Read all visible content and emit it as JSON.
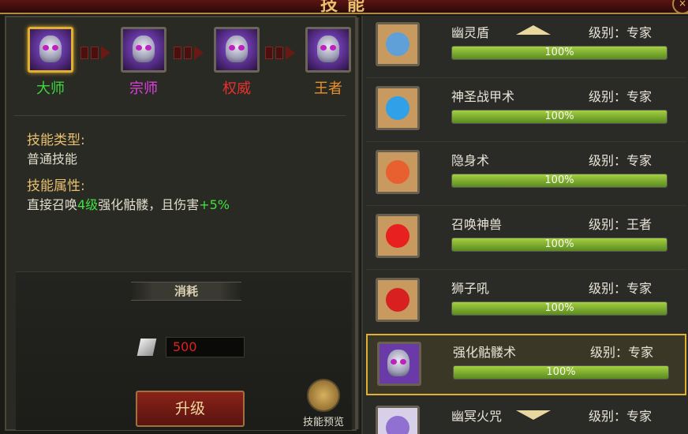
{
  "window": {
    "title": "技能",
    "close_icon": "close-icon"
  },
  "tiers": [
    {
      "label": "大师",
      "color": "#3cd83c",
      "selected": true
    },
    {
      "label": "宗师",
      "color": "#e040e0",
      "selected": false
    },
    {
      "label": "权威",
      "color": "#e83030",
      "selected": false
    },
    {
      "label": "王者",
      "color": "#e8902a",
      "selected": false
    }
  ],
  "info": {
    "type_heading": "技能类型:",
    "type_value": "普通技能",
    "attr_heading": "技能属性:",
    "attr_prefix": "直接召唤",
    "attr_level": "4级",
    "attr_mid": "强化骷髅，且伤害",
    "attr_bonus": "+5%"
  },
  "cost": {
    "banner": "消耗",
    "value": "500"
  },
  "upgrade_label": "升级",
  "preview_label": "技能预览",
  "skills": [
    {
      "name": "幽灵盾",
      "level": "级别：专家",
      "progress": "100%",
      "icon": "ghost-shield-icon",
      "icon_color": "#60a0d8"
    },
    {
      "name": "神圣战甲术",
      "level": "级别：专家",
      "progress": "100%",
      "icon": "holy-armor-icon",
      "icon_color": "#30a0e8"
    },
    {
      "name": "隐身术",
      "level": "级别：专家",
      "progress": "100%",
      "icon": "stealth-icon",
      "icon_color": "#e86030"
    },
    {
      "name": "召唤神兽",
      "level": "级别：王者",
      "progress": "100%",
      "icon": "summon-beast-icon",
      "icon_color": "#e82020"
    },
    {
      "name": "狮子吼",
      "level": "级别：专家",
      "progress": "100%",
      "icon": "lion-roar-icon",
      "icon_color": "#d82020"
    },
    {
      "name": "强化骷髅术",
      "level": "级别：专家",
      "progress": "100%",
      "icon": "skeleton-icon",
      "icon_color": "#8a50c8",
      "selected": true
    },
    {
      "name": "幽冥火咒",
      "level": "级别：专家",
      "progress": "",
      "icon": "netherfire-icon",
      "icon_color": "#9070d0"
    }
  ]
}
